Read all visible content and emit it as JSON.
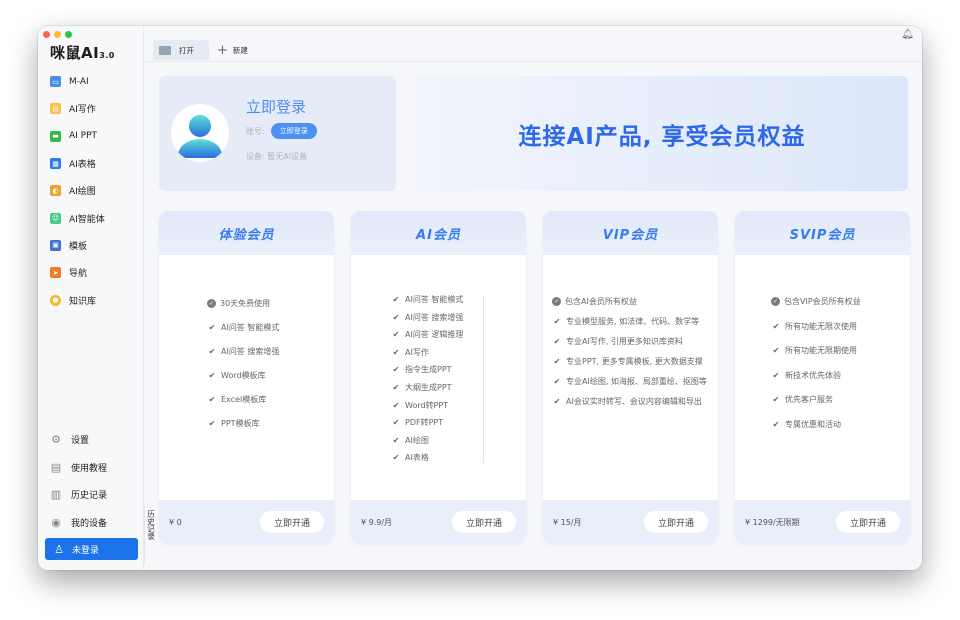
{
  "window": {
    "brand": "咪鼠AI",
    "brand_version": "3.0"
  },
  "sidebar": {
    "items": [
      {
        "label": "M-AI",
        "color": "#4a90e2"
      },
      {
        "label": "AI写作",
        "color": "#f5c242"
      },
      {
        "label": "AI PPT",
        "color": "#3bb54a"
      },
      {
        "label": "AI表格",
        "color": "#2d7be5"
      },
      {
        "label": "AI绘图",
        "color": "#f0a230"
      },
      {
        "label": "AI智能体",
        "color": "#4cc98a"
      },
      {
        "label": "模板",
        "color": "#3a72d8"
      },
      {
        "label": "导航",
        "color": "#f07c28"
      },
      {
        "label": "知识库",
        "color": "#f5b82e"
      }
    ],
    "bottom_items": [
      {
        "label": "设置",
        "icon": "gear-icon"
      },
      {
        "label": "使用教程",
        "icon": "tutorial-icon"
      },
      {
        "label": "历史记录",
        "icon": "history-icon"
      },
      {
        "label": "我的设备",
        "icon": "device-icon"
      }
    ],
    "login_label": "未登录",
    "history_strip": "历史记录"
  },
  "tabs": {
    "open_tab": "打开",
    "new_tab": "新建"
  },
  "profile": {
    "title": "立即登录",
    "account_label": "账号:",
    "login_pill": "立即登录",
    "device_label": "设备: 暂无AI设备"
  },
  "banner": {
    "text": "连接AI产品, 享受会员权益"
  },
  "plans": [
    {
      "name": "体验会员",
      "price": "¥ 0",
      "button": "立即开通",
      "features": [
        "30天免费使用",
        "AI问答 智能模式",
        "AI问答 搜索增强",
        "Word模板库",
        "Excel模板库",
        "PPT模板库"
      ]
    },
    {
      "name": "AI会员",
      "price": "¥ 9.9/月",
      "button": "立即开通",
      "features": [
        "AI问答 智能模式",
        "AI问答 搜索增强",
        "AI问答 逻辑推理",
        "AI写作",
        "指令生成PPT",
        "大纲生成PPT",
        "Word转PPT",
        "PDF转PPT",
        "AI绘图",
        "AI表格"
      ]
    },
    {
      "name": "VIP会员",
      "price": "¥ 15/月",
      "button": "立即开通",
      "features": [
        "包含AI会员所有权益",
        "专业模型服务, 如法律、代码、数学等",
        "专业AI写作, 引用更多知识库资料",
        "专业PPT, 更多专属模板, 更大数据支撑",
        "专业AI绘图, 如海报、局部重绘、抠图等",
        "AI会议实时转写、会议内容编辑和导出"
      ]
    },
    {
      "name": "SVIP会员",
      "price": "¥ 1299/无限期",
      "button": "立即开通",
      "features": [
        "包含VIP会员所有权益",
        "所有功能无限次使用",
        "所有功能无限期使用",
        "新技术优先体验",
        "优先客户服务",
        "专属优惠和活动"
      ]
    }
  ]
}
